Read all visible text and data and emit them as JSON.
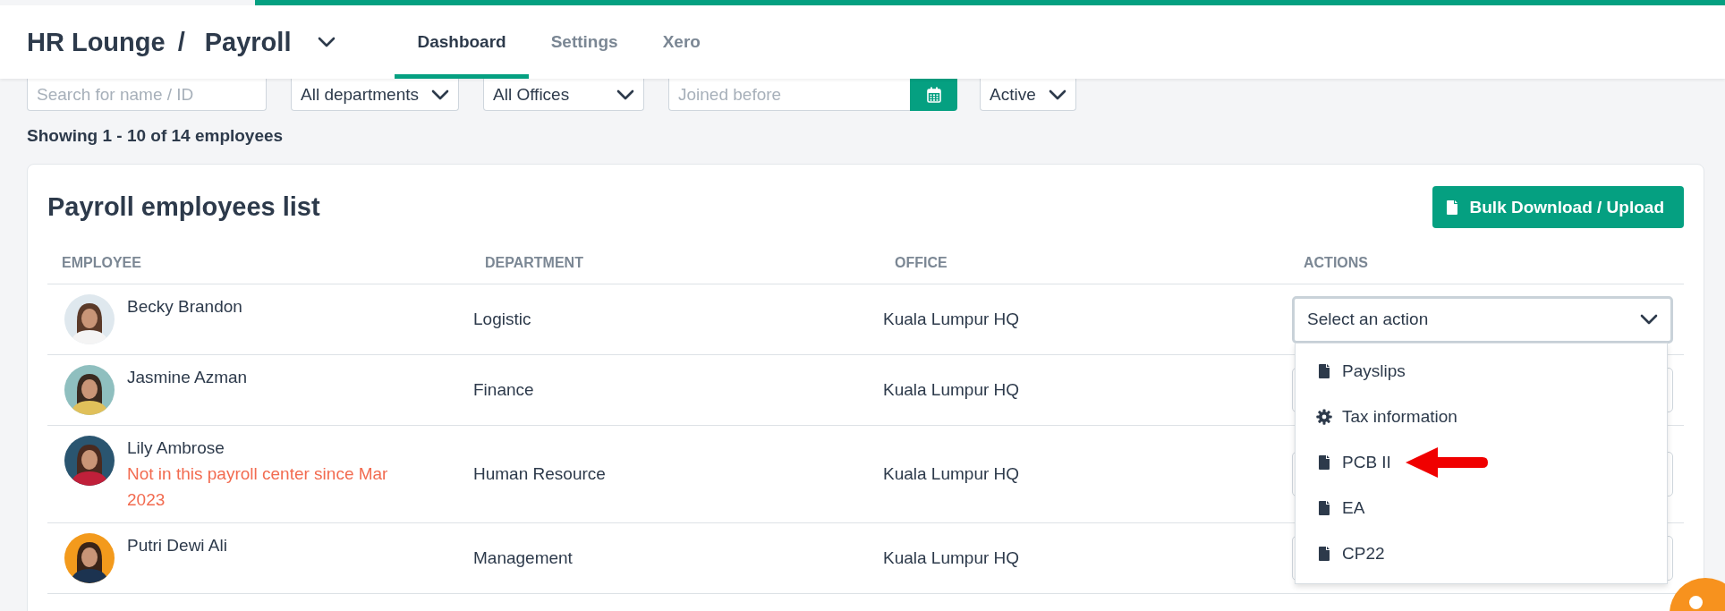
{
  "header": {
    "company": "HR Lounge",
    "separator": "/",
    "module": "Payroll",
    "tabs": [
      {
        "label": "Dashboard",
        "selected": true
      },
      {
        "label": "Settings",
        "selected": false
      },
      {
        "label": "Xero",
        "selected": false
      }
    ]
  },
  "filters": [
    {
      "kind": "search",
      "placeholder": "Search for name / ID"
    },
    {
      "kind": "select",
      "value": "All departments"
    },
    {
      "kind": "select",
      "value": "All Offices"
    },
    {
      "kind": "date",
      "placeholder": "Joined before"
    },
    {
      "kind": "select",
      "value": "Active"
    }
  ],
  "summary": "Showing 1 - 10 of 14 employees",
  "card": {
    "title": "Payroll employees list",
    "bulk_button": "Bulk Download / Upload"
  },
  "table": {
    "columns": [
      "EMPLOYEE",
      "DEPARTMENT",
      "OFFICE",
      "ACTIONS"
    ],
    "rows": [
      {
        "name": "Becky Brandon",
        "color": "#dfe8ee",
        "department": "Logistic",
        "office": "Kuala Lumpur HQ",
        "action_select": "Select an action"
      },
      {
        "name": "Jasmine Azman",
        "color": "#8fbfbf",
        "department": "Finance",
        "office": "Kuala Lumpur HQ"
      },
      {
        "name": "Lily Ambrose",
        "color": "#2a5570",
        "note": "Not in this payroll center since Mar 2023",
        "department": "Human Resource",
        "office": "Kuala Lumpur HQ"
      },
      {
        "name": "Putri Dewi Ali",
        "color": "#f39a1c",
        "department": "Management",
        "office": "Kuala Lumpur HQ"
      }
    ]
  },
  "action_menu": {
    "open": true,
    "items": [
      {
        "label": "Payslips",
        "kind": "file",
        "pointed": false
      },
      {
        "label": "Tax information",
        "kind": "gear",
        "pointed": false
      },
      {
        "label": "PCB II",
        "kind": "file",
        "pointed": true
      },
      {
        "label": "EA",
        "kind": "file",
        "pointed": false
      },
      {
        "label": "CP22",
        "kind": "file",
        "pointed": false
      }
    ]
  }
}
